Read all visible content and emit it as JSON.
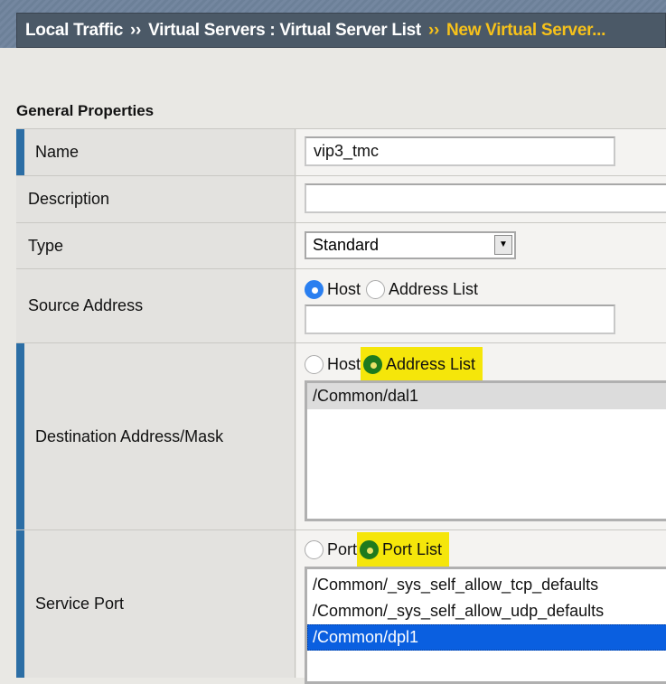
{
  "breadcrumb": {
    "items": [
      "Local Traffic",
      "Virtual Servers : Virtual Server List"
    ],
    "separator": "››",
    "current": "New Virtual Server..."
  },
  "section_title": "General Properties",
  "fields": {
    "name": {
      "label": "Name",
      "value": "vip3_tmc"
    },
    "description": {
      "label": "Description",
      "value": ""
    },
    "type": {
      "label": "Type",
      "value": "Standard"
    },
    "source": {
      "label": "Source Address",
      "options": [
        "Host",
        "Address List"
      ],
      "selected": "Host",
      "value": ""
    },
    "destination": {
      "label": "Destination Address/Mask",
      "options": [
        "Host",
        "Address List"
      ],
      "selected": "Address List",
      "list": [
        "/Common/dal1"
      ],
      "list_selected": "/Common/dal1"
    },
    "service_port": {
      "label": "Service Port",
      "options": [
        "Port",
        "Port List"
      ],
      "selected": "Port List",
      "list": [
        "/Common/_sys_self_allow_tcp_defaults",
        "/Common/_sys_self_allow_udp_defaults",
        "/Common/dpl1"
      ],
      "list_selected": "/Common/dpl1"
    }
  },
  "colors": {
    "highlight": "#f5e60a",
    "selected_radio": "#1e7a1e",
    "selected_list": "#0a5fe0",
    "crumb_current": "#f7c21a"
  }
}
